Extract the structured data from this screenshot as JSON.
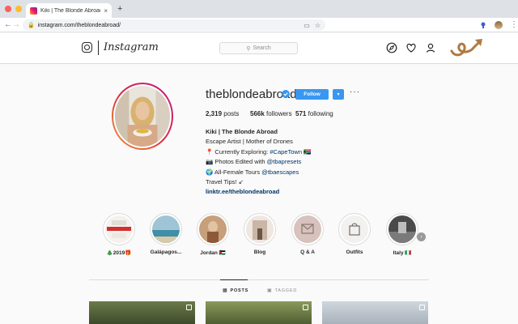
{
  "browser": {
    "tab_title": "Kiki | The Blonde Abroad (@the",
    "tab_close": "×",
    "new_tab": "+",
    "url": "instagram.com/theblondeabroad/",
    "back": "←",
    "forward": "→",
    "reload": "C",
    "lock": "🔒",
    "menu": "⋮"
  },
  "header": {
    "wordmark": "Instagram",
    "search_placeholder": "Search",
    "icons": [
      "compass-icon",
      "heart-icon",
      "user-icon"
    ]
  },
  "profile": {
    "username": "theblondeabroad",
    "follow_label": "Follow",
    "caret": "▾",
    "more": "···",
    "posts_count": "2,319",
    "posts_label": "posts",
    "followers_count": "566k",
    "followers_label": "followers",
    "following_count": "571",
    "following_label": "following",
    "bio_name": "Kiki | The Blonde Abroad",
    "bio_line1": "Escape Artist | Mother of Drones",
    "bio_line2_prefix": "📍 Currently Exploring: ",
    "bio_line2_tag": "#CapeTown",
    "bio_line2_suffix": " 🇿🇦",
    "bio_line3_prefix": "📷 Photos Edited with ",
    "bio_line3_tag": "@tbapresets",
    "bio_line4_prefix": "🌍 All-Female Tours ",
    "bio_line4_tag": "@tbaescapes",
    "bio_line5": "Travel Tips! ↙",
    "bio_link": "linktr.ee/theblondeabroad"
  },
  "highlights": [
    {
      "label": "🎄2019🎁"
    },
    {
      "label": "Galápagos..."
    },
    {
      "label": "Jordan 🇯🇴"
    },
    {
      "label": "Blog"
    },
    {
      "label": "Q & A"
    },
    {
      "label": "Outfits"
    },
    {
      "label": "Italy 🇮🇹"
    }
  ],
  "tabs": {
    "posts": "POSTS",
    "tagged": "TAGGED"
  },
  "colors": {
    "accent": "#3897f0",
    "link": "#003569",
    "border": "#dbdbdb"
  }
}
